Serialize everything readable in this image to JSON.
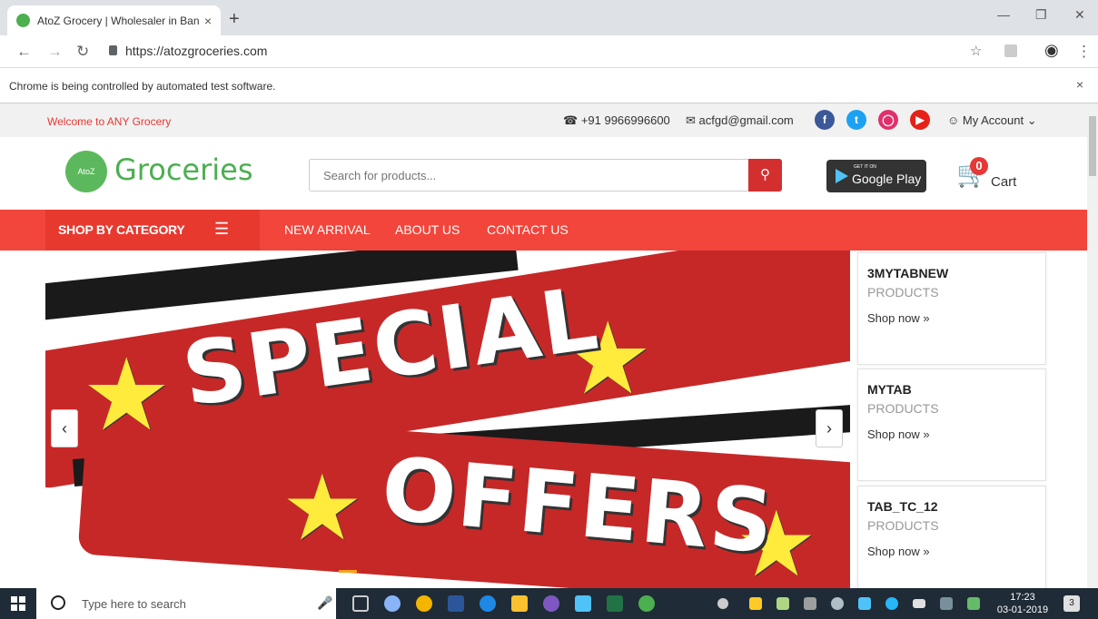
{
  "browser": {
    "tab_title": "AtoZ Grocery | Wholesaler in Ban",
    "tab_close": "×",
    "new_tab": "+",
    "url": "https://atozgroceries.com",
    "infobar_text": "Chrome is being controlled by automated test software.",
    "infobar_close": "×"
  },
  "topbar": {
    "welcome": "Welcome to ANY Grocery",
    "phone": "+91 9966996600",
    "email": "acfgd@gmail.com",
    "account": "My Account"
  },
  "header": {
    "logo_badge": "AtoZ",
    "logo_text": "Groceries",
    "search_placeholder": "Search for products...",
    "google_play_small": "GET IT ON",
    "google_play_big": "Google Play",
    "cart_count": "0",
    "cart_label": "Cart"
  },
  "nav": {
    "shop_by_category": "SHOP BY CATEGORY",
    "links": [
      "NEW ARRIVAL",
      "ABOUT US",
      "CONTACT US"
    ]
  },
  "banner": {
    "word1": "SPECIAL",
    "word2": "OFFERS"
  },
  "cards": [
    {
      "title": "3MYTABNEW",
      "subtitle": "PRODUCTS",
      "link": "Shop now »"
    },
    {
      "title": "MYTAB",
      "subtitle": "PRODUCTS",
      "link": "Shop now »"
    },
    {
      "title": "TAB_TC_12",
      "subtitle": "PRODUCTS",
      "link": "Shop now »"
    }
  ],
  "taskbar": {
    "search_placeholder": "Type here to search",
    "time": "17:23",
    "date": "03-01-2019",
    "notification_count": "3"
  },
  "colors": {
    "accent_red": "#f2453b",
    "brand_green": "#4caf50"
  }
}
